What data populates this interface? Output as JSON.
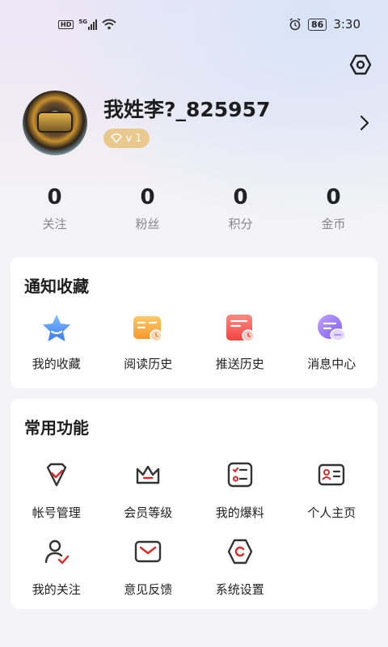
{
  "status_bar": {
    "hd": "HD",
    "network": "5G",
    "battery": "86",
    "time": "3:30"
  },
  "profile": {
    "username": "我姓李?_825957",
    "vip_level": "v 1",
    "icons": [
      "settings-icon",
      "chevron-right-icon",
      "diamond-icon"
    ]
  },
  "stats": [
    {
      "value": "0",
      "label": "关注"
    },
    {
      "value": "0",
      "label": "粉丝"
    },
    {
      "value": "0",
      "label": "积分"
    },
    {
      "value": "0",
      "label": "金币"
    }
  ],
  "notify_section": {
    "title": "通知收藏",
    "items": [
      {
        "label": "我的收藏",
        "icon": "star-icon"
      },
      {
        "label": "阅读历史",
        "icon": "book-clock-icon"
      },
      {
        "label": "推送历史",
        "icon": "push-history-icon"
      },
      {
        "label": "消息中心",
        "icon": "message-icon"
      }
    ]
  },
  "common_section": {
    "title": "常用功能",
    "items": [
      {
        "label": "帐号管理",
        "icon": "account-shield-icon"
      },
      {
        "label": "会员等级",
        "icon": "crown-icon"
      },
      {
        "label": "我的爆料",
        "icon": "checklist-icon"
      },
      {
        "label": "个人主页",
        "icon": "id-card-icon"
      },
      {
        "label": "我的关注",
        "icon": "user-check-icon"
      },
      {
        "label": "意见反馈",
        "icon": "envelope-icon"
      },
      {
        "label": "系统设置",
        "icon": "hex-settings-icon"
      }
    ]
  },
  "colors": {
    "accent": "#d92b2b",
    "gold": "#e9c98e",
    "icon_dark": "#333333"
  }
}
